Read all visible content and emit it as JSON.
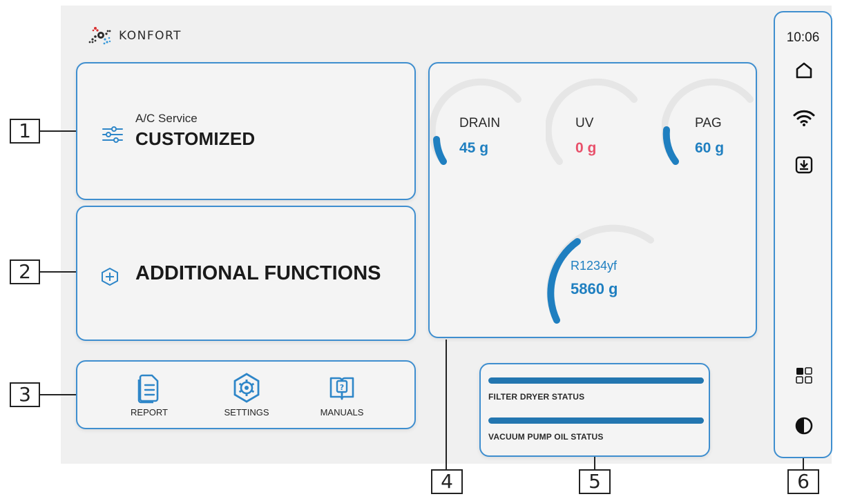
{
  "brand": {
    "name": "KONFORT"
  },
  "ac_service": {
    "label": "A/C Service",
    "value": "CUSTOMIZED",
    "icon": "sliders-icon"
  },
  "additional_functions": {
    "label": "ADDITIONAL FUNCTIONS",
    "icon": "plus-hexagon-icon"
  },
  "quick_actions": [
    {
      "label": "REPORT",
      "icon": "report-document-icon"
    },
    {
      "label": "SETTINGS",
      "icon": "settings-gear-hexagon-icon"
    },
    {
      "label": "MANUALS",
      "icon": "manual-book-icon"
    }
  ],
  "gauges": {
    "drain": {
      "name": "DRAIN",
      "value": "45 g",
      "color": "#1f7fc0"
    },
    "uv": {
      "name": "UV",
      "value": "0 g",
      "color": "#e8506a"
    },
    "pag": {
      "name": "PAG",
      "value": "60 g",
      "color": "#1f7fc0"
    },
    "refrigerant": {
      "name": "R1234yf",
      "value": "5860 g",
      "color": "#1f7fc0"
    }
  },
  "status": {
    "filter_dryer": {
      "label": "FILTER DRYER STATUS",
      "level": 1.0
    },
    "vacuum_pump_oil": {
      "label": "VACUUM PUMP OIL STATUS",
      "level": 1.0
    }
  },
  "sidebar": {
    "time": "10:06",
    "icons": [
      "home-icon",
      "wifi-icon",
      "download-icon",
      "apps-grid-icon",
      "contrast-icon"
    ]
  },
  "callouts": [
    "1",
    "2",
    "3",
    "4",
    "5",
    "6"
  ],
  "colors": {
    "accent": "#3e8ecf",
    "value_blue": "#1f7fc0",
    "value_red": "#e8506a",
    "bar": "#2376b0"
  }
}
